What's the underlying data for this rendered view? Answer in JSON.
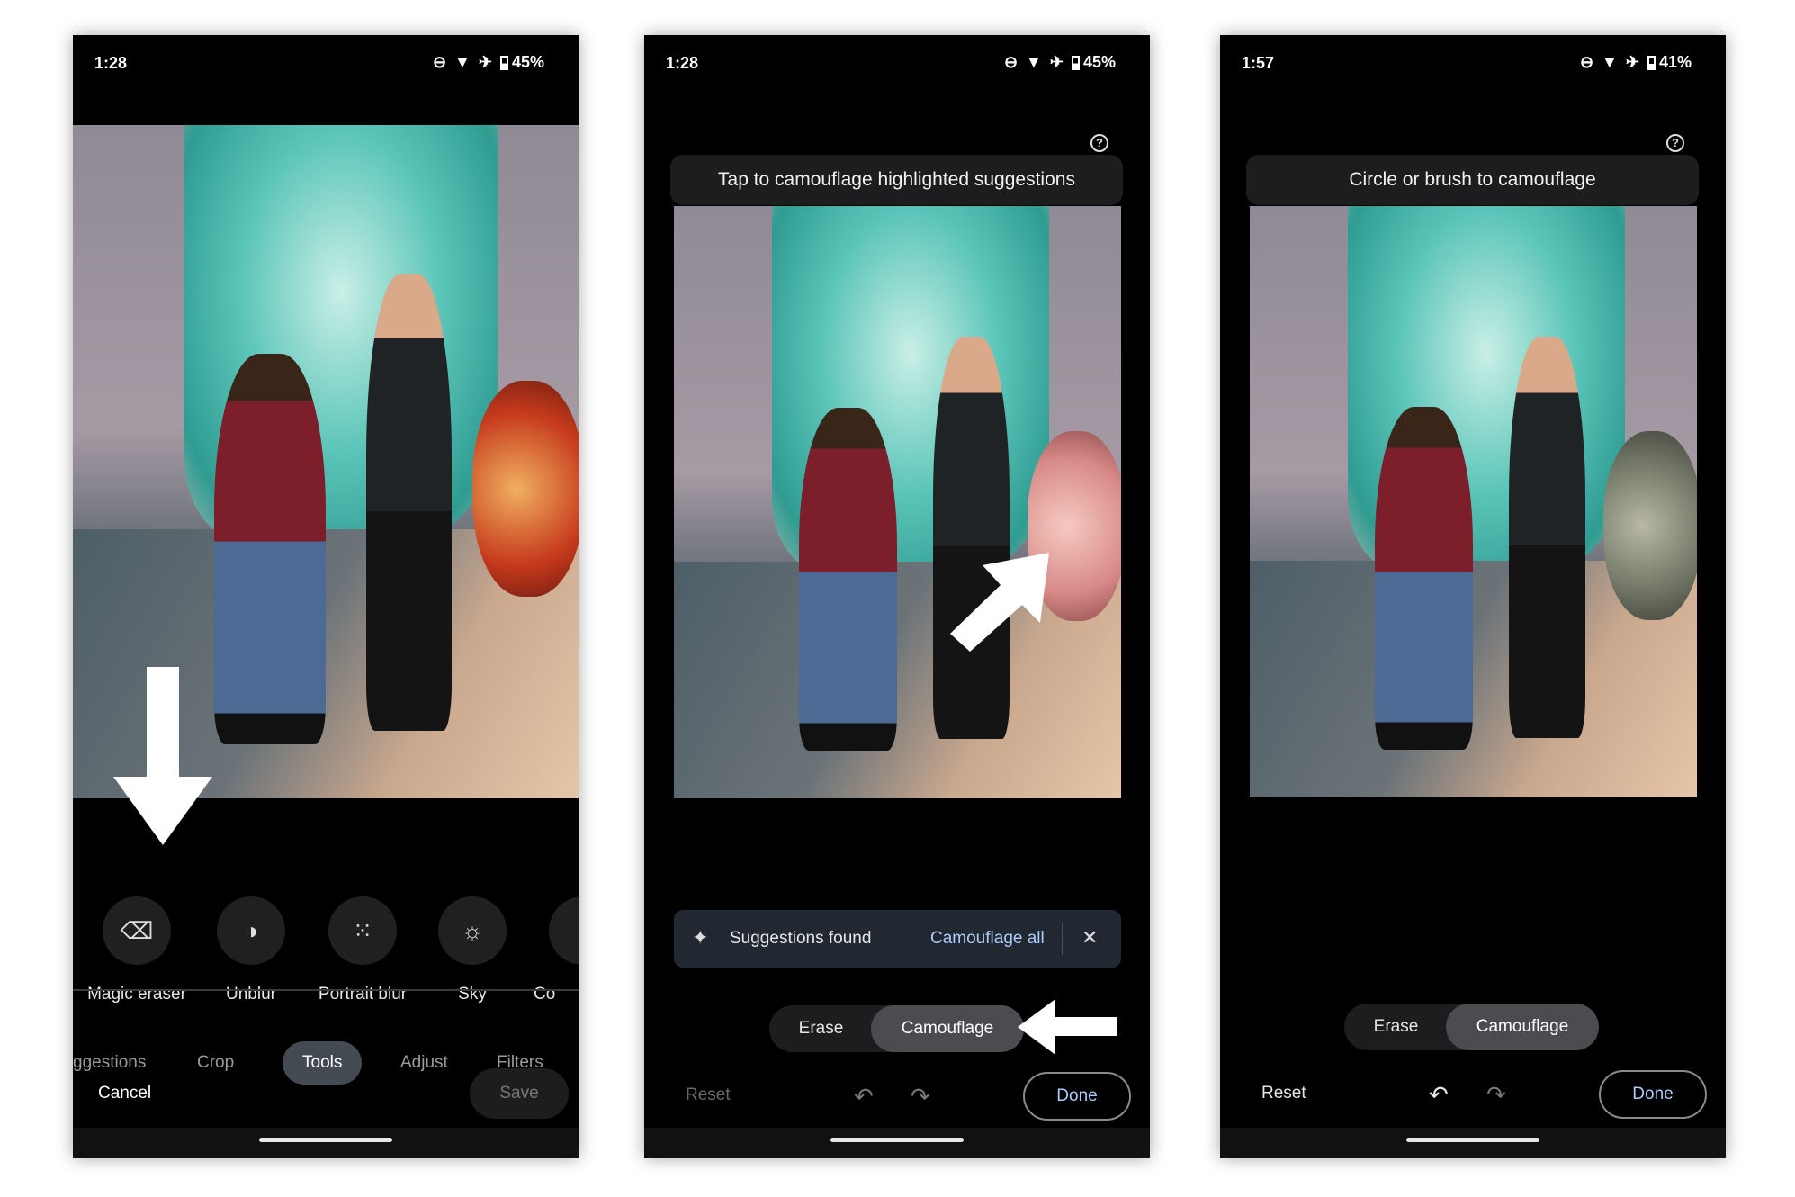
{
  "colors": {
    "accent": "#aecbfa",
    "background": "#000000",
    "chip": "#444a52"
  },
  "screens": [
    {
      "status": {
        "time": "1:28",
        "battery": "45%",
        "icons": [
          "dnd-icon",
          "wifi-icon",
          "airplane-icon",
          "battery-icon"
        ]
      },
      "tools": [
        {
          "label": "Magic eraser",
          "icon": "eraser-icon"
        },
        {
          "label": "Unblur",
          "icon": "unblur-icon"
        },
        {
          "label": "Portrait blur",
          "icon": "portrait-blur-icon"
        },
        {
          "label": "Sky",
          "icon": "sky-icon"
        },
        {
          "label": "Co",
          "icon": "color-icon"
        }
      ],
      "tabs": [
        "ggestions",
        "Crop",
        "Tools",
        "Adjust",
        "Filters"
      ],
      "active_tab": "Tools",
      "cancel": "Cancel",
      "save": "Save"
    },
    {
      "status": {
        "time": "1:28",
        "battery": "45%"
      },
      "hint": "Tap to camouflage highlighted suggestions",
      "help": "?",
      "suggestions": {
        "text": "Suggestions found",
        "action": "Camouflage all",
        "close": "✕"
      },
      "toggle": {
        "erase": "Erase",
        "camouflage": "Camouflage",
        "selected": "Camouflage"
      },
      "reset": "Reset",
      "done": "Done"
    },
    {
      "status": {
        "time": "1:57",
        "battery": "41%"
      },
      "hint": "Circle or brush to camouflage",
      "help": "?",
      "toggle": {
        "erase": "Erase",
        "camouflage": "Camouflage",
        "selected": "Camouflage"
      },
      "reset": "Reset",
      "done": "Done"
    }
  ]
}
